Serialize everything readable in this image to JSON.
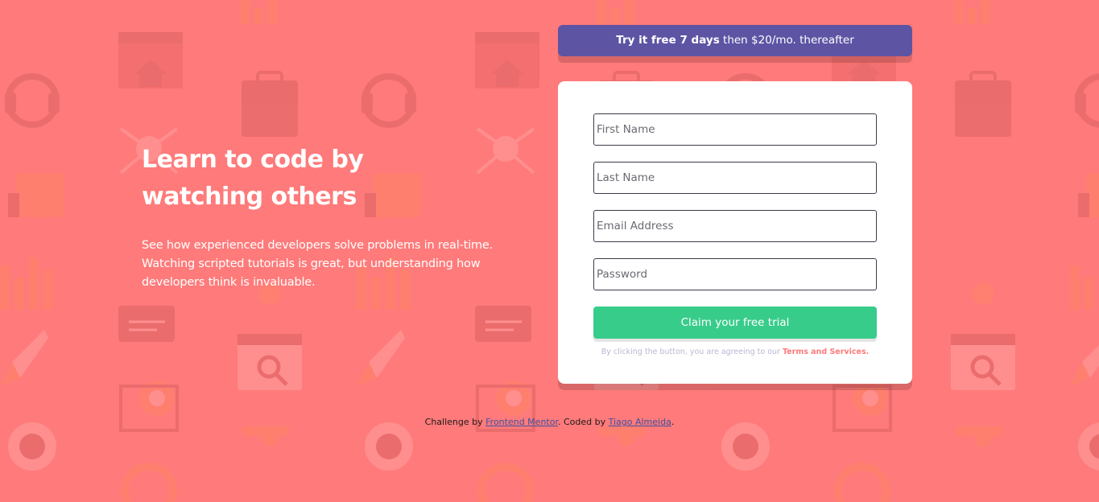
{
  "colors": {
    "background": "#ff7a7a",
    "promo_bg": "#5e54a4",
    "cta_bg": "#38cc8b",
    "card_bg": "#ffffff",
    "accent_text": "#ff7a7a"
  },
  "hero": {
    "title": "Learn to code by watching others",
    "description": "See how experienced developers solve problems in real-time. Watching scripted tutorials is great, but understanding how developers think is invaluable."
  },
  "promo": {
    "bold": "Try it free 7 days",
    "rest": " then $20/mo. thereafter"
  },
  "form": {
    "first_name": {
      "placeholder": "First Name"
    },
    "last_name": {
      "placeholder": "Last Name"
    },
    "email": {
      "placeholder": "Email Address"
    },
    "password": {
      "placeholder": "Password"
    },
    "submit_label": "Claim your free trial",
    "terms_prefix": "By clicking the button, you are agreeing to our ",
    "terms_link": "Terms and Services."
  },
  "attribution": {
    "prefix": "Challenge by ",
    "challenge_link": "Frontend Mentor",
    "middle": ". Coded by ",
    "author_link": "Tiago Almeida",
    "suffix": "."
  },
  "background_icons": [
    "web-window-icon",
    "chart-icon",
    "headset-icon",
    "toolbox-icon",
    "network-icon",
    "thumbs-up-icon",
    "rocket-icon",
    "magnifier-icon",
    "gear-icon",
    "globe-icon",
    "cart-icon",
    "pencil-icon",
    "key-icon"
  ]
}
